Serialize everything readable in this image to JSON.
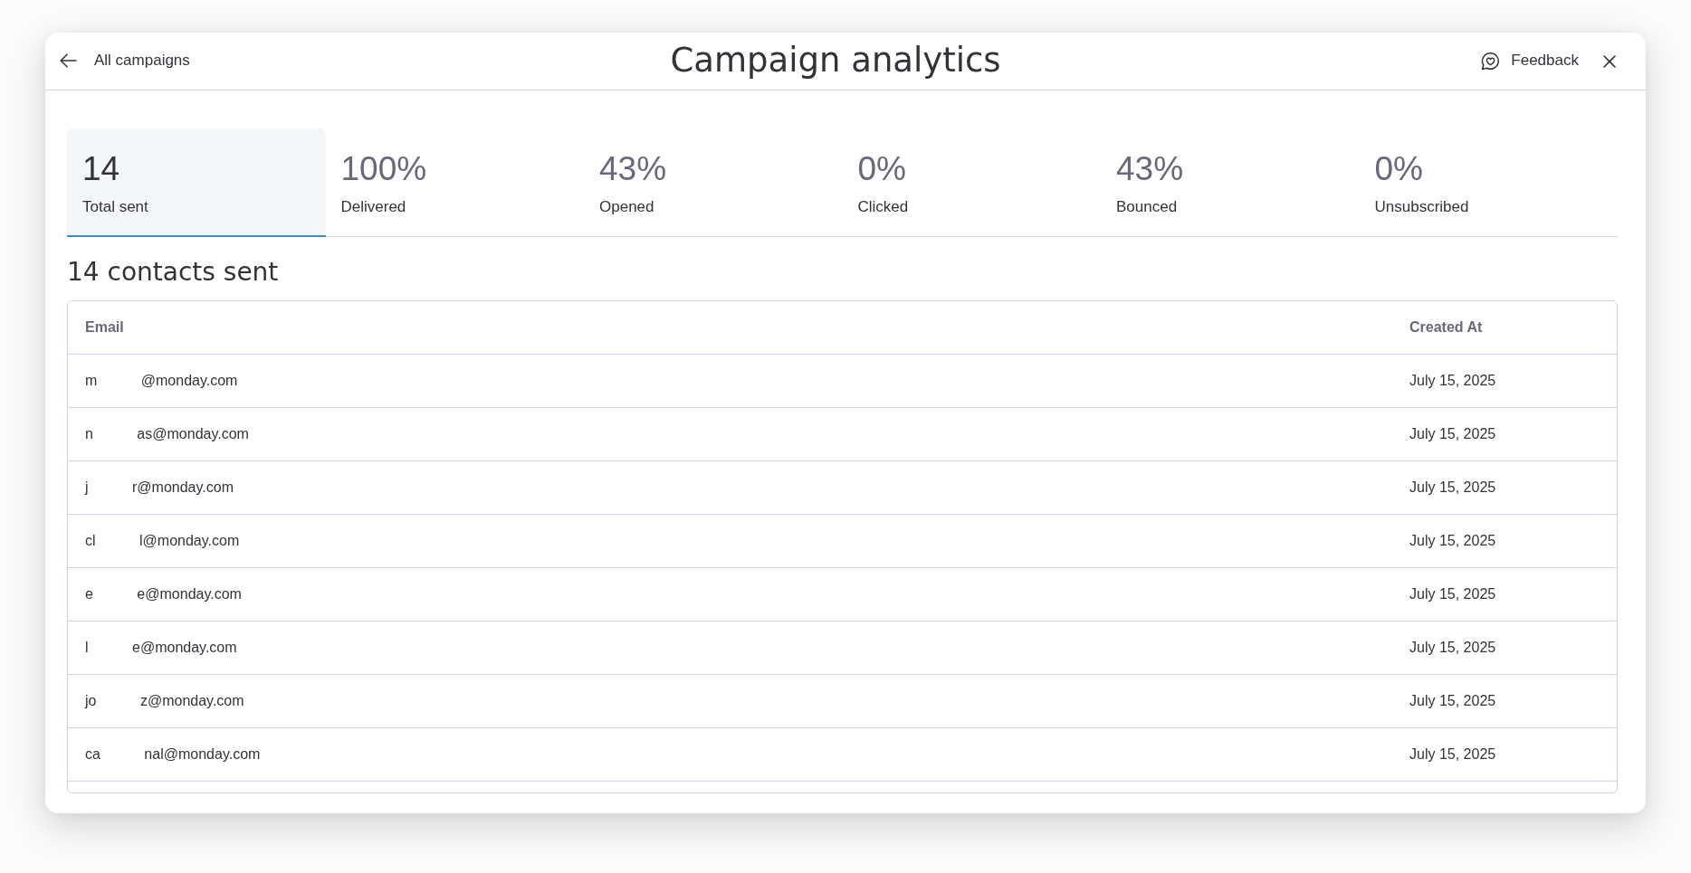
{
  "header": {
    "back_label": "All campaigns",
    "title": "Campaign analytics",
    "feedback_label": "Feedback"
  },
  "stats": [
    {
      "value": "14",
      "label": "Total sent",
      "selected": true
    },
    {
      "value": "100%",
      "label": "Delivered",
      "selected": false
    },
    {
      "value": "43%",
      "label": "Opened",
      "selected": false
    },
    {
      "value": "0%",
      "label": "Clicked",
      "selected": false
    },
    {
      "value": "43%",
      "label": "Bounced",
      "selected": false
    },
    {
      "value": "0%",
      "label": "Unsubscribed",
      "selected": false
    }
  ],
  "section_title": "14 contacts sent",
  "table": {
    "columns": [
      "Email",
      "Created At"
    ],
    "rows": [
      {
        "email_start": "m",
        "email_end": "@monday.com",
        "created_at": "July 15, 2025"
      },
      {
        "email_start": "n",
        "email_end": "as@monday.com",
        "created_at": "July 15, 2025"
      },
      {
        "email_start": "j",
        "email_end": "r@monday.com",
        "created_at": "July 15, 2025"
      },
      {
        "email_start": "cl",
        "email_end": "l@monday.com",
        "created_at": "July 15, 2025"
      },
      {
        "email_start": "e",
        "email_end": "e@monday.com",
        "created_at": "July 15, 2025"
      },
      {
        "email_start": "l",
        "email_end": "e@monday.com",
        "created_at": "July 15, 2025"
      },
      {
        "email_start": "jo",
        "email_end": "z@monday.com",
        "created_at": "July 15, 2025"
      },
      {
        "email_start": "ca",
        "email_end": "nal@monday.com",
        "created_at": "July 15, 2025"
      }
    ]
  }
}
